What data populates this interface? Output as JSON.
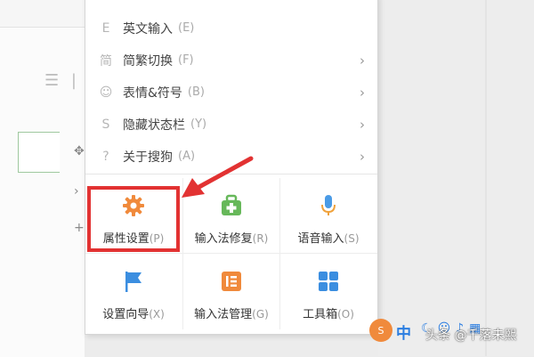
{
  "menu": {
    "items": [
      {
        "label": "英文输入",
        "shortcut": "(E)",
        "icon": "letter-e-icon",
        "glyph": "E",
        "has_submenu": false
      },
      {
        "label": "简繁切换",
        "shortcut": "(F)",
        "icon": "traditional-chinese-icon",
        "glyph": "简",
        "has_submenu": true
      },
      {
        "label": "表情&符号",
        "shortcut": "(B)",
        "icon": "smiley-icon",
        "glyph": "☺",
        "has_submenu": true
      },
      {
        "label": "隐藏状态栏",
        "shortcut": "(Y)",
        "icon": "statusbar-icon",
        "glyph": "S",
        "has_submenu": true
      },
      {
        "label": "关于搜狗",
        "shortcut": "(A)",
        "icon": "help-icon",
        "glyph": "?",
        "has_submenu": true
      }
    ],
    "submenu_arrow": "›",
    "tiles": [
      {
        "label": "属性设置",
        "shortcut": "(P)",
        "icon": "gear-icon"
      },
      {
        "label": "输入法修复",
        "shortcut": "(R)",
        "icon": "repair-kit-icon"
      },
      {
        "label": "语音输入",
        "shortcut": "(S)",
        "icon": "microphone-icon"
      },
      {
        "label": "设置向导",
        "shortcut": "(X)",
        "icon": "flag-icon"
      },
      {
        "label": "输入法管理",
        "shortcut": "(G)",
        "icon": "manager-icon"
      },
      {
        "label": "工具箱",
        "shortcut": "(O)",
        "icon": "toolbox-icon"
      }
    ]
  },
  "ime_bar": {
    "mode": "中",
    "icons": [
      "moon-icon",
      "smiley-icon",
      "microphone-icon",
      "keyboard-icon"
    ]
  },
  "watermark": "头条 @千落未熙",
  "colors": {
    "highlight": "#e23232",
    "gear": "#f08a3c",
    "repair": "#67b85a",
    "mic": "#4a9be6",
    "flag": "#3b8ee0",
    "manager": "#f08a3c",
    "toolbox": "#3b8ee0",
    "ime_blue": "#2a7de1"
  }
}
